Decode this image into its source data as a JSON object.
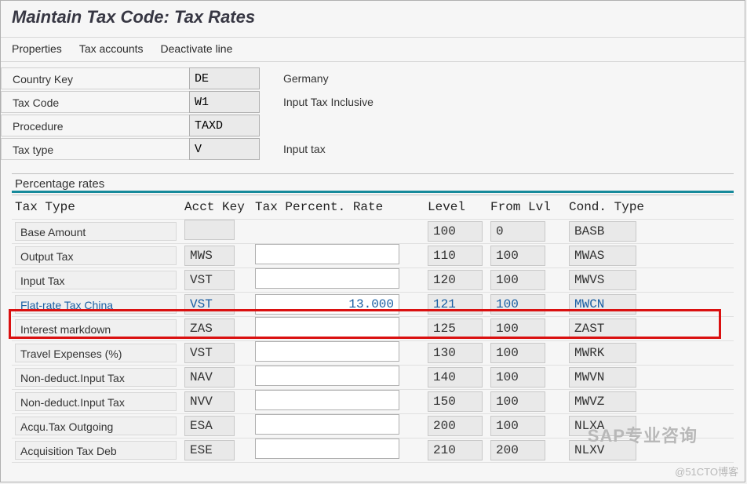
{
  "title": "Maintain Tax Code: Tax Rates",
  "toolbar": {
    "properties": "Properties",
    "tax_accounts": "Tax accounts",
    "deactivate": "Deactivate line"
  },
  "form": {
    "country_key": {
      "label": "Country Key",
      "value": "DE",
      "desc": "Germany"
    },
    "tax_code": {
      "label": "Tax Code",
      "value": "W1",
      "desc": "Input Tax Inclusive"
    },
    "procedure": {
      "label": "Procedure",
      "value": "TAXD",
      "desc": ""
    },
    "tax_type": {
      "label": "Tax type",
      "value": "V",
      "desc": "Input tax"
    }
  },
  "section_title": "Percentage rates",
  "columns": {
    "tax_type": "Tax Type",
    "acct_key": "Acct Key",
    "rate": "Tax Percent. Rate",
    "level": "Level",
    "from": "From Lvl",
    "cond": "Cond. Type"
  },
  "rows": [
    {
      "tax_type": "Base Amount",
      "acct": "",
      "rate": "",
      "level": "100",
      "from": "0",
      "cond": "BASB",
      "hl": false,
      "rate_editable": false
    },
    {
      "tax_type": "Output Tax",
      "acct": "MWS",
      "rate": "",
      "level": "110",
      "from": "100",
      "cond": "MWAS",
      "hl": false,
      "rate_editable": true
    },
    {
      "tax_type": "Input Tax",
      "acct": "VST",
      "rate": "",
      "level": "120",
      "from": "100",
      "cond": "MWVS",
      "hl": false,
      "rate_editable": true
    },
    {
      "tax_type": "Flat-rate Tax China",
      "acct": "VST",
      "rate": "13.000",
      "level": "121",
      "from": "100",
      "cond": "MWCN",
      "hl": true,
      "rate_editable": true
    },
    {
      "tax_type": "Interest markdown",
      "acct": "ZAS",
      "rate": "",
      "level": "125",
      "from": "100",
      "cond": "ZAST",
      "hl": false,
      "rate_editable": true
    },
    {
      "tax_type": "Travel Expenses (%)",
      "acct": "VST",
      "rate": "",
      "level": "130",
      "from": "100",
      "cond": "MWRK",
      "hl": false,
      "rate_editable": true
    },
    {
      "tax_type": "Non-deduct.Input Tax",
      "acct": "NAV",
      "rate": "",
      "level": "140",
      "from": "100",
      "cond": "MWVN",
      "hl": false,
      "rate_editable": true
    },
    {
      "tax_type": "Non-deduct.Input Tax",
      "acct": "NVV",
      "rate": "",
      "level": "150",
      "from": "100",
      "cond": "MWVZ",
      "hl": false,
      "rate_editable": true
    },
    {
      "tax_type": "Acqu.Tax Outgoing",
      "acct": "ESA",
      "rate": "",
      "level": "200",
      "from": "100",
      "cond": "NLXA",
      "hl": false,
      "rate_editable": true
    },
    {
      "tax_type": "Acquisition Tax Deb",
      "acct": "ESE",
      "rate": "",
      "level": "210",
      "from": "200",
      "cond": "NLXV",
      "hl": false,
      "rate_editable": true
    }
  ],
  "watermark1": "SAP专业咨询",
  "watermark2": "@51CTO博客"
}
